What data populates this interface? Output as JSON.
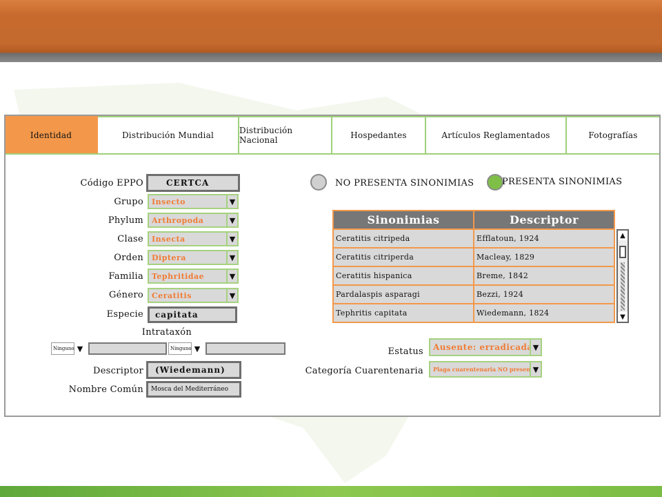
{
  "tabs": [
    {
      "label": "Identidad",
      "active": true
    },
    {
      "label": "Distribución Mundial",
      "active": false
    },
    {
      "label": "Distribución Nacional",
      "active": false
    },
    {
      "label": "Hospedantes",
      "active": false
    },
    {
      "label": "Artículos Reglamentados",
      "active": false
    },
    {
      "label": "Fotografías",
      "active": false
    }
  ],
  "form": {
    "codigo_label": "Código EPPO",
    "codigo_value": "CERTCA",
    "grupo_label": "Grupo",
    "grupo_value": "Insecto",
    "phylum_label": "Phylum",
    "phylum_value": "Arthropoda",
    "clase_label": "Clase",
    "clase_value": "Insecta",
    "orden_label": "Orden",
    "orden_value": "Diptera",
    "familia_label": "Familia",
    "familia_value": "Tephritidae",
    "genero_label": "Género",
    "genero_value": "Ceratitis",
    "especie_label": "Especie",
    "especie_value": "capitata",
    "intrataxon_label": "Intrataxón",
    "intrataxon_sel1": "Ninguno",
    "intrataxon_sel2": "Ninguno",
    "descriptor_label": "Descriptor",
    "descriptor_value": "(Wiedemann)",
    "nombre_label": "Nombre Común",
    "nombre_value": "Mosca del Mediterráneo"
  },
  "synonyms_radio": {
    "no_label": "NO PRESENTA SINONIMIAS",
    "yes_label": "PRESENTA SINONIMIAS",
    "selected": "yes"
  },
  "synonyms_table": {
    "headers": [
      "Sinonimias",
      "Descriptor"
    ],
    "rows": [
      [
        "Ceratitis citripeda",
        "Efflatoun, 1924"
      ],
      [
        "Ceratitis citriperda",
        "Macleay, 1829"
      ],
      [
        "Ceratitis hispanica",
        "Breme, 1842"
      ],
      [
        "Pardalaspis asparagi",
        "Bezzi, 1924"
      ],
      [
        "Tephritis capitata",
        "Wiedemann, 1824"
      ]
    ]
  },
  "status": {
    "estatus_label": "Estatus",
    "estatus_value": "Ausente: erradicada",
    "categoria_label": "Categoría Cuarentenaria",
    "categoria_value": "Plaga cuarentenaria NO presente"
  },
  "icons": {
    "dropdown": "▼",
    "scroll_up": "▲",
    "scroll_down": "▼"
  },
  "colors": {
    "accent_orange": "#f3984a",
    "accent_green": "#7fbf48",
    "value_orange": "#f07c35"
  }
}
